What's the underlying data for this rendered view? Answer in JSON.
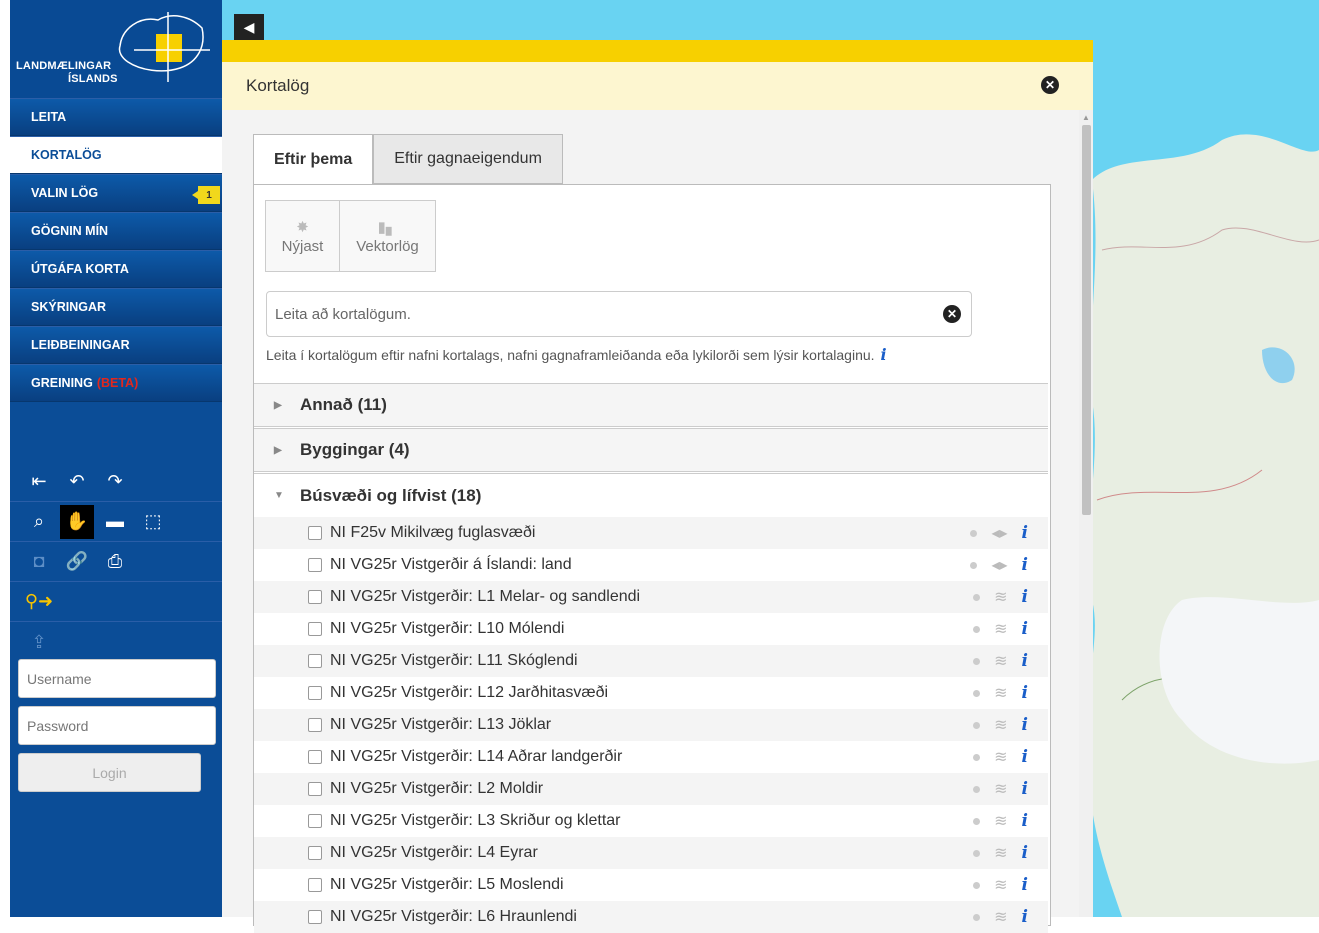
{
  "sidebar": {
    "logo": {
      "line1": "LANDMÆLINGAR",
      "line2": "ÍSLANDS"
    },
    "nav": [
      {
        "label": "LEITA"
      },
      {
        "label": "KORTALÖG",
        "active": true
      },
      {
        "label": "VALIN LÖG",
        "badge": "1"
      },
      {
        "label": "GÖGNIN MÍN"
      },
      {
        "label": "ÚTGÁFA KORTA"
      },
      {
        "label": "SKÝRINGAR"
      },
      {
        "label": "LEIÐBEININGAR"
      },
      {
        "label": "GREINING",
        "suffix": "(BETA)"
      }
    ],
    "login": {
      "username_placeholder": "Username",
      "password_placeholder": "Password",
      "button": "Login"
    }
  },
  "panel": {
    "title": "Kortalög",
    "tabs": [
      {
        "label": "Eftir þema",
        "active": true
      },
      {
        "label": "Eftir gagnaeigendum"
      }
    ],
    "filters": [
      {
        "label": "Nýjast",
        "icon": "star-icon"
      },
      {
        "label": "Vektorlög",
        "icon": "bar-chart-icon"
      }
    ],
    "search": {
      "placeholder": "Leita að kortalögum."
    },
    "hint": "Leita í kortalögum eftir nafni kortalags, nafni gagnaframleiðanda eða lykilorði sem lýsir kortalaginu.",
    "categories": [
      {
        "label": "Annað (11)",
        "open": false
      },
      {
        "label": "Byggingar (4)",
        "open": false
      },
      {
        "label": "Búsvæði og lífvist (18)",
        "open": true
      }
    ],
    "layers": [
      "NI F25v Mikilvæg fuglasvæði",
      "NI VG25r Vistgerðir á Íslandi: land",
      "NI VG25r Vistgerðir: L1 Melar- og sandlendi",
      "NI VG25r Vistgerðir: L10 Mólendi",
      "NI VG25r Vistgerðir: L11 Skóglendi",
      "NI VG25r Vistgerðir: L12 Jarðhitasvæði",
      "NI VG25r Vistgerðir: L13 Jöklar",
      "NI VG25r Vistgerðir: L14 Aðrar landgerðir",
      "NI VG25r Vistgerðir: L2 Moldir",
      "NI VG25r Vistgerðir: L3 Skriður og klettar",
      "NI VG25r Vistgerðir: L4 Eyrar",
      "NI VG25r Vistgerðir: L5 Moslendi",
      "NI VG25r Vistgerðir: L6 Hraunlendi"
    ],
    "info_symbol": "i"
  },
  "colors": {
    "sidebar": "#0b4d97",
    "accent": "#f7d000",
    "beta": "#e2271d",
    "info": "#1a5ec9"
  }
}
